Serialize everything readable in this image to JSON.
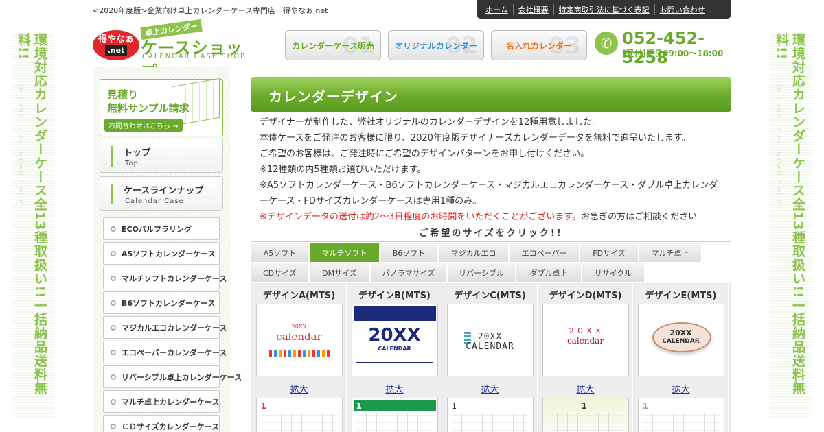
{
  "header": {
    "breadcrumb": "<2020年度版>企業向け卓上カレンダーケース専門店　得やなぁ.net",
    "nav": [
      "ホーム",
      "会社概要",
      "特定商取引法に基づく表記",
      "お問い合わせ"
    ],
    "logo": {
      "mark_top": "得やなぁ",
      "mark_net": ".net",
      "small": "卓上カレンダー",
      "big": "ケースショップ",
      "en": "CALENDAR CASE SHOP"
    },
    "buttons": [
      {
        "num": "01",
        "label": "カレンダーケース販売"
      },
      {
        "num": "02",
        "label": "オリジナルカレンダー"
      },
      {
        "num": "03",
        "label": "名入れカレンダー"
      }
    ],
    "phone": {
      "number": "052-452-5258",
      "hours": "[受付]平日09:00～18:00"
    }
  },
  "side_banner": {
    "text": "環境対応カレンダーケース全13種取扱い!!一括納品送料無料!!",
    "sub": "ORIGINAL CALENDAR SHOP"
  },
  "sidebar": {
    "sample": {
      "line1": "見積り",
      "line2": "無料サンプル請求",
      "cta": "お問合わせはこちら →"
    },
    "big_items": [
      {
        "jp": "トップ",
        "en": "Top"
      },
      {
        "jp": "ケースラインナップ",
        "en": "Calendar Case"
      }
    ],
    "items": [
      "ECOパルプラリング",
      "A5ソフトカレンダーケース",
      "マルチソフトカレンダーケース",
      "B6ソフトカレンダーケース",
      "マジカルエコカレンダーケース",
      "エコペーパーカレンダーケース",
      "リバーシブル卓上カレンダーケース",
      "マルチ卓上カレンダーケース",
      "ＣＤサイズカレンダーケース"
    ]
  },
  "main": {
    "title": "カレンダーデザイン",
    "desc": [
      "デザイナーが制作した、弊社オリジナルのカレンダーデザインを12種用意しました。",
      "本体ケースをご発注のお客様に限り、2020年度版デザイナーズカレンダーデータを無料で進呈いたします。",
      "ご希望のお客様は、ご発注時にご希望のデザインパターンをお申し付けください。",
      "※12種類の内5種類お選びいただけます。",
      "※A5ソフトカレンダーケース・B6ソフトカレンダーケース・マジカルエコカレンダーケース・ダブル卓上カレンダーケース・FDサイズカレンダーケースは専用1種のみ。"
    ],
    "notice_red": "※デザインデータの送付は約2～3日程度のお時間をいただくことがございます。",
    "notice_rest": "お急ぎの方はご相談ください",
    "click_bar": "ご希望のサイズをクリック!!",
    "tabs_row1": [
      "A5ソフト",
      "マルチソフト",
      "B6ソフト",
      "マジカルエコ",
      "エコペーパー",
      "FDサイズ",
      "マルチ卓上"
    ],
    "tabs_row2": [
      "CDサイズ",
      "DMサイズ",
      "パノラマサイズ",
      "リバーシブル",
      "ダブル卓上",
      "リサイクル"
    ],
    "active_tab": "マルチソフト",
    "zoom_label": "拡大",
    "cards": [
      {
        "name": "デザインA(MTS)",
        "art1": "20XX",
        "art2": "calendar",
        "month": "1"
      },
      {
        "name": "デザインB(MTS)",
        "art1": "20XX",
        "art2": "CALENDAR",
        "month": "1"
      },
      {
        "name": "デザインC(MTS)",
        "art1": "20XX",
        "art2": "CALENDAR",
        "month": "1"
      },
      {
        "name": "デザインD(MTS)",
        "art1": "２０ＸＸ",
        "art2": "calendar",
        "month": "1"
      },
      {
        "name": "デザインE(MTS)",
        "art1": "20XX",
        "art2": "CALENDAR",
        "month": "1"
      }
    ]
  },
  "colors": {
    "green": "#6aaa2a",
    "light_green": "#8cc34a",
    "red": "#e02020",
    "link": "#1a2fae",
    "dark": "#333333"
  },
  "icons": {
    "phone": "phone-icon"
  }
}
